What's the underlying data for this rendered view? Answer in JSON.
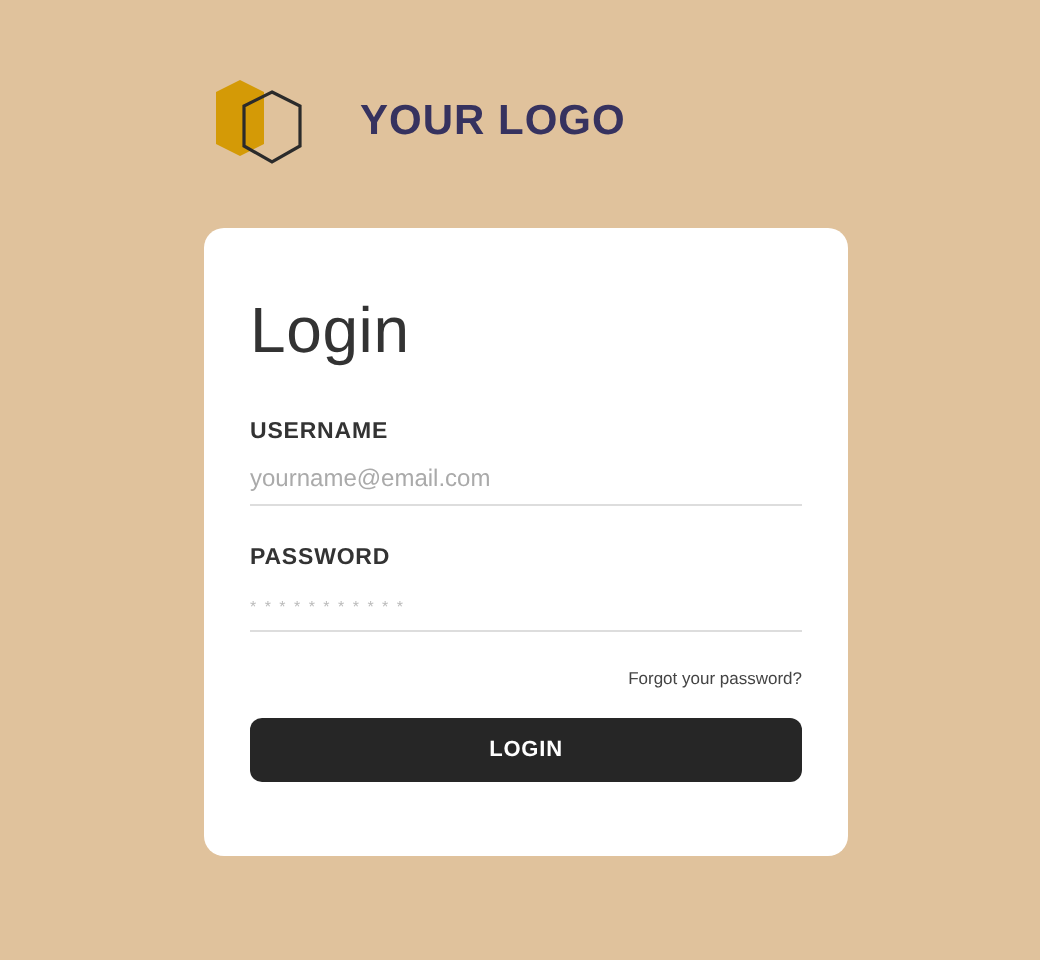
{
  "logo": {
    "text": "YOUR LOGO"
  },
  "login_card": {
    "title": "Login",
    "fields": [
      {
        "label": "USERNAME",
        "placeholder": "yourname@email.com",
        "kind": "text"
      },
      {
        "label": "PASSWORD",
        "placeholder": "* * * * * * * * * * *",
        "kind": "password"
      }
    ],
    "forgot_link": "Forgot your password?",
    "button": "LOGIN"
  }
}
